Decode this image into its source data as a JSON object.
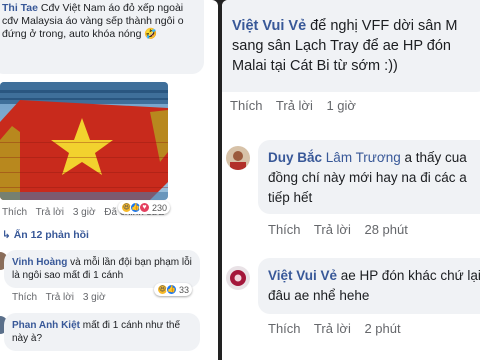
{
  "left": {
    "top_comment": {
      "name": "Thi Tae",
      "text": " Cđv Việt Nam áo đỏ xếp ngoài cđv Malaysia áo vàng sếp thành ngôi o đứng ở trong, auto khóa nóng 🤣"
    },
    "actions_1": {
      "like": "Thích",
      "reply": "Trả lời",
      "time": "3 giờ",
      "edited": "Đã chỉnh sửa",
      "reaction_count": "230"
    },
    "hide_replies": "Ẩn 12 phản hồi",
    "reply_1": {
      "name": "Vinh Hoàng",
      "text": " và mỗi lần đội bạn phạm lỗi là ngôi sao mất đi 1 cánh"
    },
    "actions_2": {
      "like": "Thích",
      "reply": "Trả lời",
      "time": "3 giờ",
      "reaction_count": "33"
    },
    "reply_2": {
      "name": "Phan Anh Kiệt",
      "text": " mất đi 1 cánh như thế này à?"
    }
  },
  "right": {
    "comment_1": {
      "name": "Việt Vui Vẻ",
      "text": " để nghị VFF dời sân M sang sân Lạch Tray để ae HP đón Malai tại Cát Bi từ sớm :))"
    },
    "actions_1": {
      "like": "Thích",
      "reply": "Trả lời",
      "time": "1 giờ"
    },
    "comment_2": {
      "name": "Duy Bắc",
      "mention": "Lâm Trương",
      "text": " a thấy cua đồng chí này mới hay na đi các a tiếp hết"
    },
    "actions_2": {
      "like": "Thích",
      "reply": "Trả lời",
      "time": "28 phút"
    },
    "comment_3": {
      "name": "Việt Vui Vẻ",
      "text": " ae HP đón khác chứ lại đâu ae nhể hehe"
    },
    "actions_3": {
      "like": "Thích",
      "reply": "Trả lời",
      "time": "2 phút"
    }
  },
  "colors": {
    "name_blue": "#385898",
    "bubble_gray": "#f0f2f5",
    "meta_gray": "#65676b",
    "like_blue": "#1877f2",
    "haha_yellow": "#f7b928"
  }
}
